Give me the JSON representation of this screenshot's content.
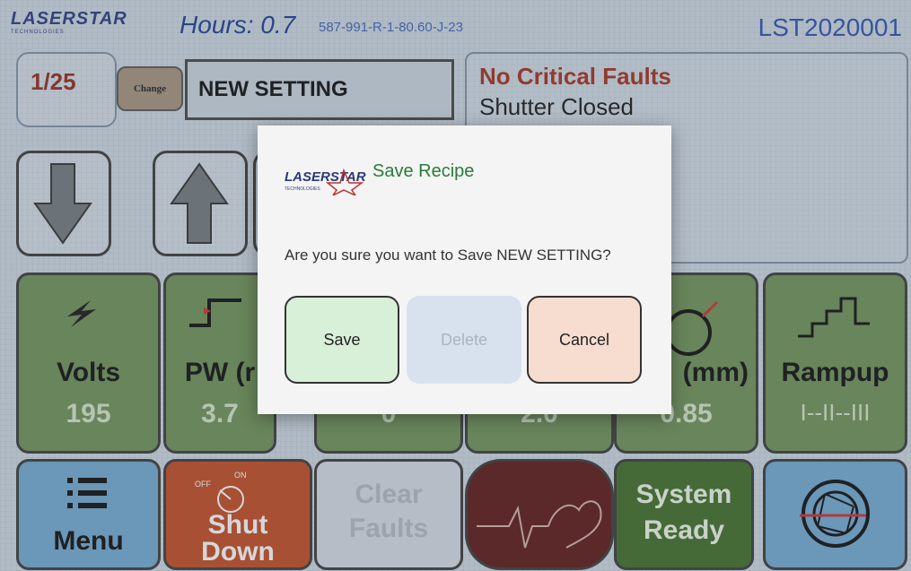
{
  "header": {
    "logo_text": "LASERSTAR",
    "logo_subtext": "TECHNOLOGIES",
    "hours": "Hours: 0.7",
    "serial": "587-991-R-1-80.60-J-23",
    "device_id": "LST2020001"
  },
  "recipe": {
    "number": "1/25",
    "change_label": "Change",
    "name": "NEW SETTING"
  },
  "status": {
    "fault": "No Critical Faults",
    "shutter": "Shutter Closed"
  },
  "params": [
    {
      "label": "Volts",
      "value": "195"
    },
    {
      "label": "PW (r",
      "value": "3.7"
    },
    {
      "label": "",
      "value": "0"
    },
    {
      "label": "",
      "value": "2.0"
    },
    {
      "label": "(mm)",
      "value": "0.85"
    },
    {
      "label": "Rampup",
      "value": "I--II--III"
    }
  ],
  "bottom": {
    "menu": "Menu",
    "shutdown": "Shut Down",
    "shutdown_line1": "Shut",
    "shutdown_line2": "Down",
    "clear_line1": "Clear",
    "clear_line2": "Faults",
    "system_line1": "System",
    "system_line2": "Ready",
    "off_label": "OFF",
    "on_label": "ON"
  },
  "dialog": {
    "title": "Save Recipe",
    "message": "Are you sure you want to Save NEW SETTING?",
    "save_label": "Save",
    "delete_label": "Delete",
    "cancel_label": "Cancel"
  },
  "colors": {
    "param_tile": "#6b8a55",
    "save_button": "#d8f0d8",
    "delete_button": "#d8e2ee",
    "cancel_button": "#f6ddd0",
    "shutdown": "#b84a25",
    "system_ready": "#3f6a2a",
    "heart_tile": "#5a1a18",
    "menu_tile": "#6da0c6"
  }
}
